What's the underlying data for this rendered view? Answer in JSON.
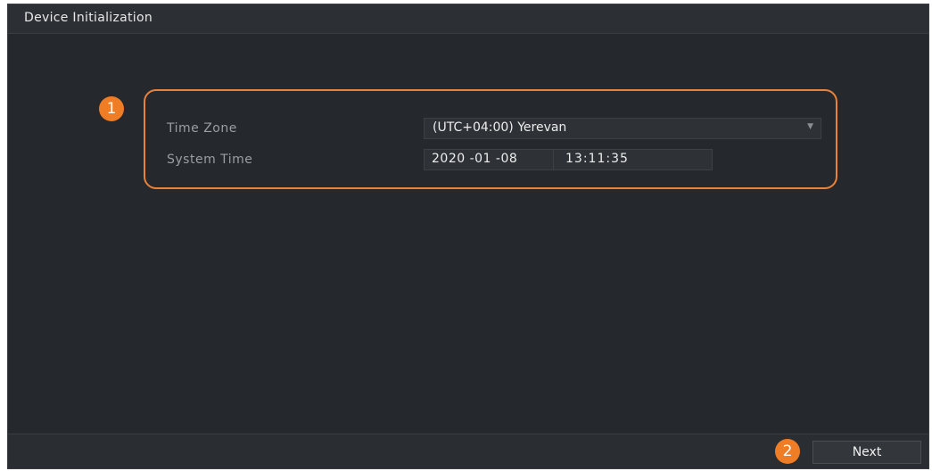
{
  "window": {
    "title": "Device Initialization"
  },
  "callouts": {
    "one": "1",
    "two": "2"
  },
  "time_zone": {
    "label": "Time Zone",
    "value": "(UTC+04:00) Yerevan",
    "icon": "chevron-down-icon"
  },
  "system_time": {
    "label": "System Time",
    "date": "2020 -01 -08",
    "time": "13:11:35"
  },
  "footer": {
    "next_label": "Next"
  },
  "colors": {
    "accent_orange": "#ee7d26",
    "panel_background": "#25282d"
  }
}
